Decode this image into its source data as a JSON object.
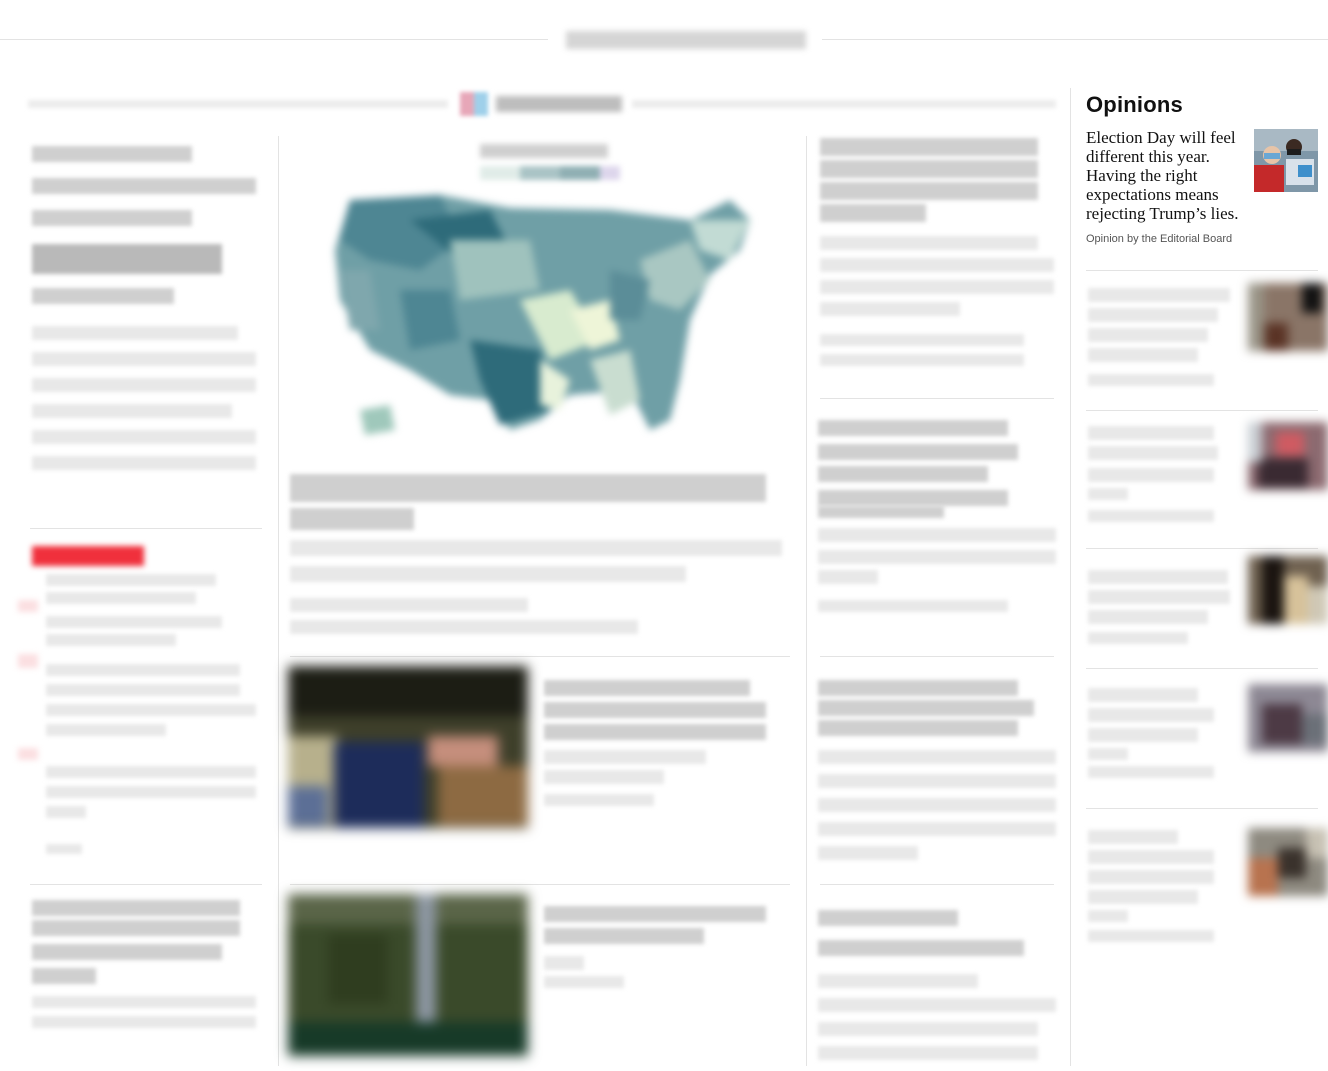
{
  "opinions": {
    "section_title": "Opinions",
    "lead": {
      "headline": "Election Day will feel different this year. Having the right expectations means rejecting Trump’s lies.",
      "byline": "Opinion by the Editorial Board",
      "photo_icon": "healthcare-worker-photo"
    }
  },
  "colors": {
    "map_dark": "#2e6b7a",
    "map_mid": "#6f9fa6",
    "map_light": "#b9d6d0",
    "map_pale": "#e8f2dc",
    "breaking_red": "#f0303c",
    "rule": "#e3e3e3"
  }
}
